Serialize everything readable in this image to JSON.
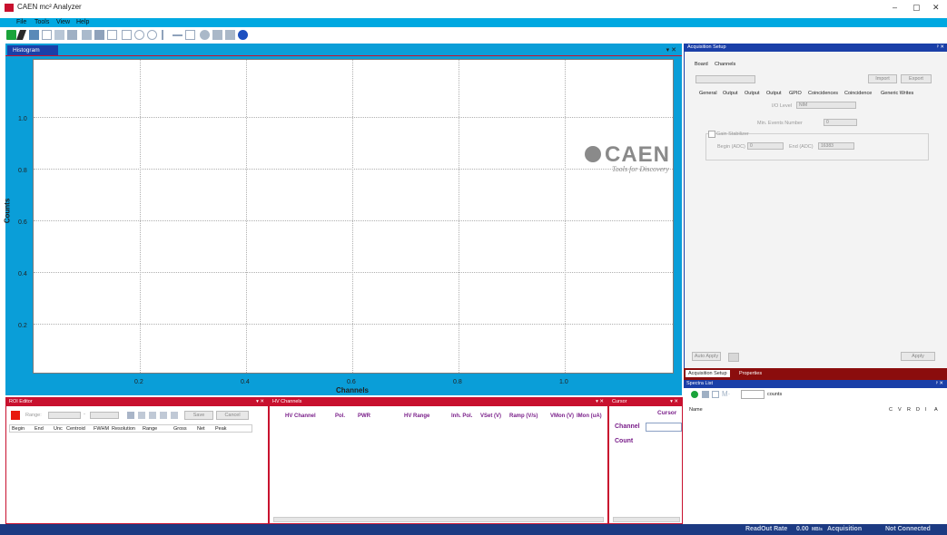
{
  "window": {
    "title": "CAEN mc² Analyzer",
    "minimize": "–",
    "maximize": "▢",
    "close": "✕"
  },
  "menu": [
    "File",
    "Tools",
    "View",
    "Help"
  ],
  "histogram": {
    "tab_label": "Histogram",
    "close_label": "▾ ✕",
    "xlabel": "Channels",
    "ylabel": "Counts",
    "xticks": [
      "0.2",
      "0.4",
      "0.6",
      "0.8",
      "1.0"
    ],
    "yticks": [
      "0.2",
      "0.4",
      "0.6",
      "0.8",
      "1.0"
    ],
    "logo_text": "CAEN",
    "logo_tagline": "Tools for Discovery"
  },
  "roi_editor": {
    "title": "ROI Editor",
    "range_label": "Range:",
    "range_sep": "-",
    "save_label": "Save",
    "cancel_label": "Cancel",
    "columns": [
      "Begin",
      "End",
      "Unc",
      "Centroid",
      "FWHM",
      "Resolution",
      "Range",
      "Gross",
      "Net",
      "Peak"
    ]
  },
  "hv_channels": {
    "title": "HV Channels",
    "columns": [
      "HV Channel",
      "Pol.",
      "PWR",
      "HV Range",
      "Inh. Pol.",
      "VSet (V)",
      "Ramp (V/s)",
      "VMon (V)",
      "IMon (uA)"
    ]
  },
  "cursor": {
    "title": "Cursor",
    "heading": "Cursor",
    "channel_label": "Channel",
    "count_label": "Count"
  },
  "acquisition_setup": {
    "title": "Acquisition Setup",
    "top_tabs": [
      "Board",
      "Channels"
    ],
    "import_label": "Import",
    "export_label": "Export",
    "sub_tabs": [
      "General",
      "Output",
      "Output",
      "Output",
      "GPIO",
      "Coincidences",
      "Coincidence",
      "Generic Writes"
    ],
    "io_level_label": "I/O Level",
    "io_level_value": "NIM",
    "min_events_label": "Min. Events Number",
    "min_events_value": "0",
    "gain_stabilizer_label": "Gain Stabilizer",
    "begin_label": "Begin (ADC)",
    "begin_value": "0",
    "end_label": "End (ADC)",
    "end_value": "16383",
    "auto_apply_label": "Auto Apply",
    "apply_label": "Apply"
  },
  "lower_tabs": [
    "Acquisition Setup",
    "Properties"
  ],
  "spectra_list": {
    "title": "Spectra List",
    "counts_label": "counts",
    "name_header": "Name",
    "flag_headers": [
      "C",
      "V",
      "R",
      "D",
      "I",
      "A"
    ]
  },
  "status": {
    "readout_label": "ReadOut Rate",
    "readout_value": "0.00",
    "readout_unit": "MB/s",
    "acquisition_label": "Acquisition",
    "connection": "Not Connected"
  },
  "colors": {
    "accent": "#00a8e1",
    "panel_border": "#c8102e",
    "header_blue": "#1a3fa8",
    "statusbar": "#1c3a82"
  }
}
